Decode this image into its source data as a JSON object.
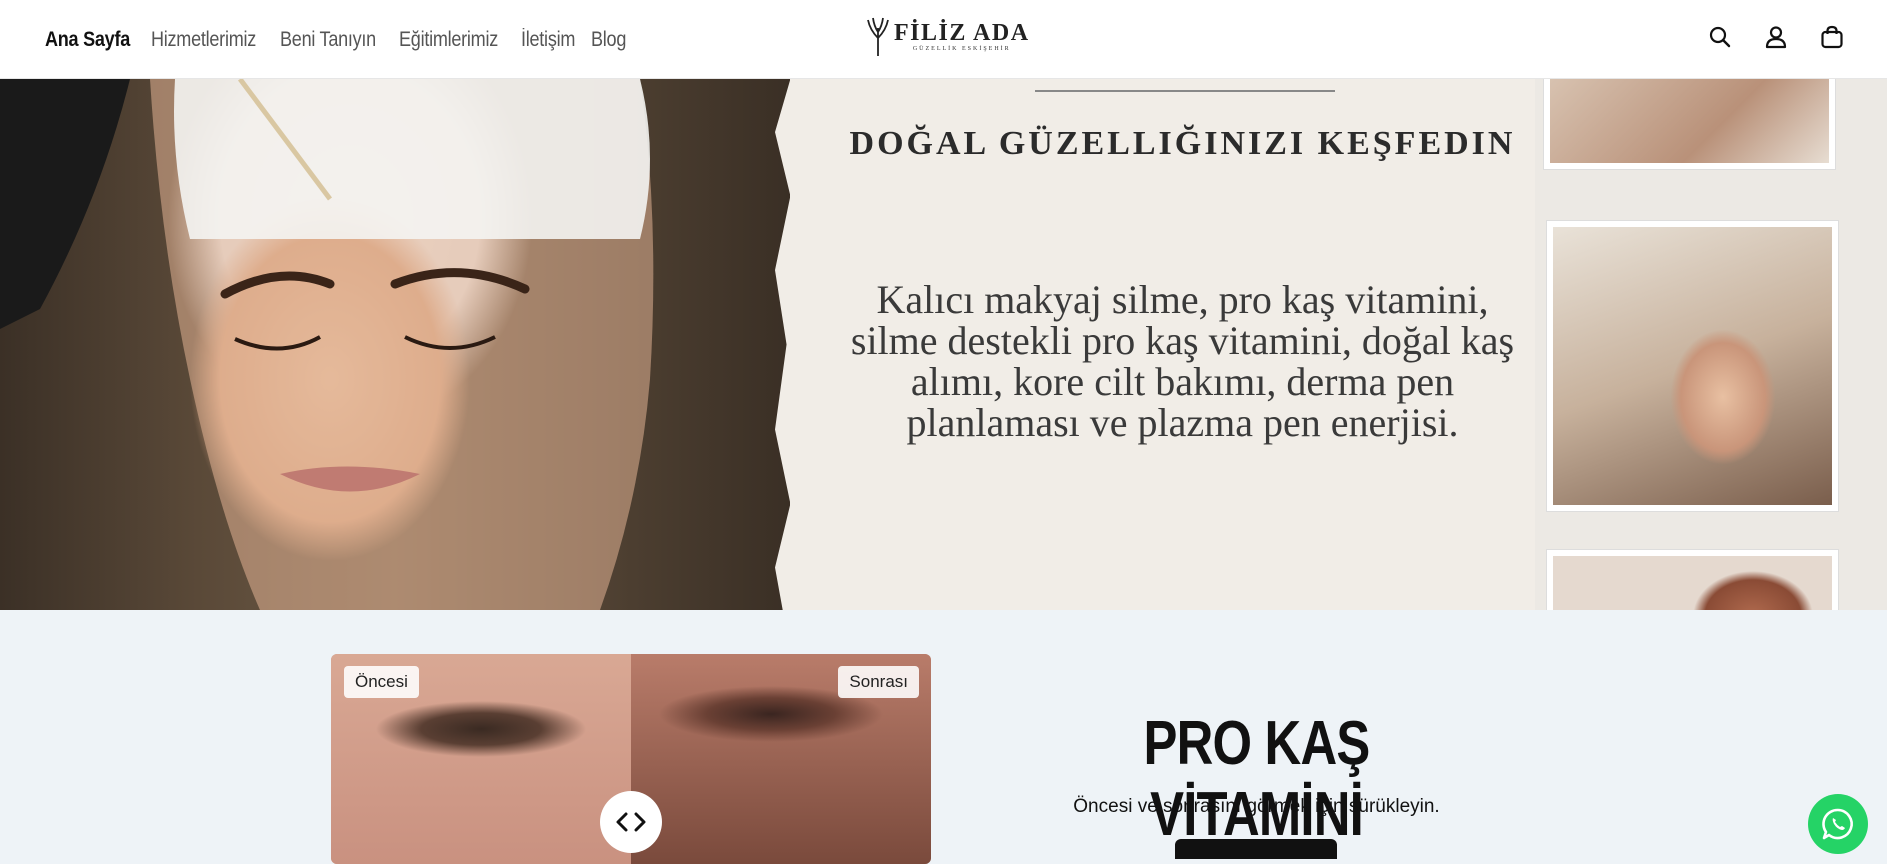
{
  "nav": {
    "items": [
      "Ana Sayfa",
      "Hizmetlerimiz",
      "Beni Tanıyın",
      "Eğitimlerimiz",
      "İletişim",
      "Blog"
    ],
    "active": "Ana Sayfa"
  },
  "logo": {
    "name": "FİLİZ ADA",
    "sub": "GÜZELLİK   ESKİŞEHİR"
  },
  "header_icons": [
    "search-icon",
    "user-icon",
    "cart-icon"
  ],
  "hero": {
    "heading": "DOĞAL GÜZELLIĞINIZI KEŞFEDIN",
    "body": "Kalıcı makyaj silme, pro kaş vitamini, silme destekli pro kaş vitamini, doğal kaş alımı, kore cilt bakımı, derma pen planlaması ve plazma pen enerjisi."
  },
  "compare": {
    "before_label": "Öncesi",
    "after_label": "Sonrası",
    "handle_icon": "arrows-left-right-icon"
  },
  "feature": {
    "title": "PRO KAŞ VİTAMİNİ",
    "subtitle": "Öncesi ve sonrasını görmek için sürükleyin."
  },
  "colors": {
    "whatsapp": "#25d366",
    "dark": "#111111",
    "section_bg": "#eef3f7"
  }
}
